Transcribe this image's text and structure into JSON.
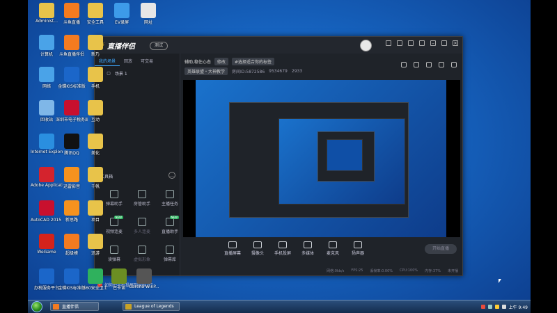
{
  "desktop_icons": [
    {
      "label": "Administ...",
      "color": "#e8c34a"
    },
    {
      "label": "斗鱼直播",
      "color": "#f47b20"
    },
    {
      "label": "安全工具",
      "color": "#e8c34a"
    },
    {
      "label": "EV录屏",
      "color": "#3d9be9"
    },
    {
      "label": "网址",
      "color": "#e6e6e6"
    },
    {
      "label": "计算机",
      "color": "#4aa3e8"
    },
    {
      "label": "斗鱼直播伴侣",
      "color": "#f47b20"
    },
    {
      "label": "新乃",
      "color": "#e8c34a"
    },
    {
      "label": "网络",
      "color": "#4aa3e8"
    },
    {
      "label": "金蝶KIS标准版",
      "color": "#1b66c9"
    },
    {
      "label": "手机",
      "color": "#e8c34a"
    },
    {
      "label": "回收站",
      "color": "#7fb7e8"
    },
    {
      "label": "深圳市电子税务局",
      "color": "#c8102e"
    },
    {
      "label": "互动",
      "color": "#e8c34a"
    },
    {
      "label": "Internet Explorer",
      "color": "#2a8fe0"
    },
    {
      "label": "腾讯QQ",
      "color": "#111111"
    },
    {
      "label": "美化",
      "color": "#e8c34a"
    },
    {
      "label": "Adobe Applicati...",
      "color": "#d4232d"
    },
    {
      "label": "迅雷影音",
      "color": "#f6921e"
    },
    {
      "label": "千帆",
      "color": "#e8c34a"
    },
    {
      "label": "AutoCAD 2015 - 简体",
      "color": "#c8102e"
    },
    {
      "label": "新思路",
      "color": "#f6921e"
    },
    {
      "label": "项目",
      "color": "#e8c34a"
    },
    {
      "label": "WeGame",
      "color": "#d4231b"
    },
    {
      "label": "超级模",
      "color": "#f47b20"
    },
    {
      "label": "迅游",
      "color": "#e8c34a"
    },
    {
      "label": "办税服务平台",
      "color": "#1b66c9"
    },
    {
      "label": "金蝶KIS标准版",
      "color": "#1b66c9"
    },
    {
      "label": "360安全卫士",
      "color": "#2fb15d"
    },
    {
      "label": "巴卡诺",
      "color": "#6b8e23"
    },
    {
      "label": "Garena WinP...",
      "color": "#555555"
    }
  ],
  "taskbar": {
    "items": [
      {
        "label": "直播伴侣",
        "color": "#f47b20"
      },
      {
        "label": "League of Legends",
        "color": "#c9a227"
      }
    ],
    "clock": "上午 9:49"
  },
  "app": {
    "logo_text": "直播伴侣",
    "version_pill": "测试",
    "sidebar_tabs": [
      "我的场景",
      "回放",
      "可交易"
    ],
    "scene_name": "场景 1",
    "toolbox_title": "工具箱",
    "tools": [
      {
        "label": "弹幕助手",
        "dim": false
      },
      {
        "label": "房管助手",
        "dim": false
      },
      {
        "label": "主播任务",
        "dim": false
      },
      {
        "label": "视频连麦",
        "dim": false,
        "badge": "NEW"
      },
      {
        "label": "多人连麦",
        "dim": true
      },
      {
        "label": "直播助手",
        "dim": false,
        "badge": "NEW"
      },
      {
        "label": "读弹幕",
        "dim": false
      },
      {
        "label": "虚拟形象",
        "dim": true
      },
      {
        "label": "弹幕库",
        "dim": false
      }
    ],
    "tip_text": "如何把手机投屏到电脑上？",
    "room_title": "辅助,稳住心态",
    "room_chip_1": "修改",
    "room_chip_2": "#选择适合你的标签",
    "room_meta_1": "英雄联盟・大神教学",
    "room_meta_2": "房间ID:5872586",
    "room_meta_3": "9534679",
    "room_meta_4": "2933",
    "controls": [
      "直播屏幕",
      "摄像头",
      "手机投屏",
      "多媒体",
      "麦克风",
      "扬声器"
    ],
    "go_live": "开始直播",
    "status": [
      "网络:0kb/s",
      "FPS:25",
      "丢帧率:0.00%",
      "CPU:100%",
      "内存:37%",
      "未开播"
    ]
  }
}
